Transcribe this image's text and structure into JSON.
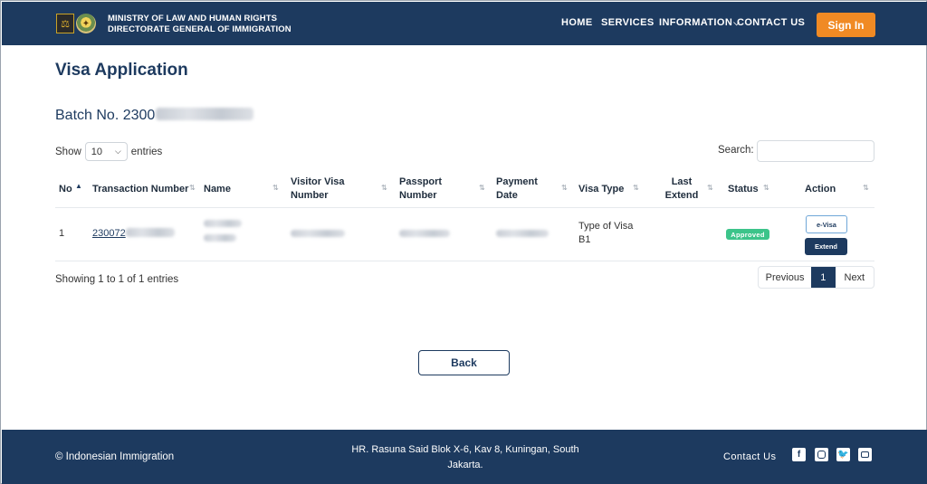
{
  "header": {
    "ministry_line1": "MINISTRY OF LAW AND HUMAN RIGHTS",
    "ministry_line2": "DIRECTORATE GENERAL OF IMMIGRATION",
    "nav": {
      "home": "HOME",
      "services": "SERVICES",
      "information": "INFORMATION",
      "contact": "CONTACT US"
    },
    "sign_in": "Sign In"
  },
  "main": {
    "title": "Visa Application",
    "batch_prefix": "Batch No. 2300",
    "show_label": "Show",
    "entries_value": "10",
    "entries_label": "entries",
    "search_label": "Search:",
    "search_value": ""
  },
  "table": {
    "columns": [
      "No",
      "Transaction Number",
      "Name",
      "Visitor Visa Number",
      "Passport Number",
      "Payment Date",
      "Visa Type",
      "Last Extend",
      "Status",
      "Action"
    ],
    "rows": [
      {
        "no": "1",
        "transaction_prefix": "230072",
        "visa_type_line1": "Type of Visa",
        "visa_type_line2": "B1",
        "last_extend": "",
        "status": "Approved",
        "action_evisa": "e-Visa",
        "action_extend": "Extend"
      }
    ]
  },
  "footer_table": {
    "showing": "Showing 1 to 1 of 1 entries",
    "previous": "Previous",
    "current_page": "1",
    "next": "Next"
  },
  "back_label": "Back",
  "footer": {
    "copyright": "© Indonesian Immigration",
    "address": "HR. Rasuna Said Blok X-6, Kav 8, Kuningan, South Jakarta.",
    "contact": "Contact Us"
  },
  "colors": {
    "primary": "#1d3a5f",
    "accent": "#f08a24",
    "approved": "#3cc48a"
  },
  "icons": [
    "facebook-icon",
    "instagram-icon",
    "twitter-icon",
    "youtube-icon"
  ]
}
